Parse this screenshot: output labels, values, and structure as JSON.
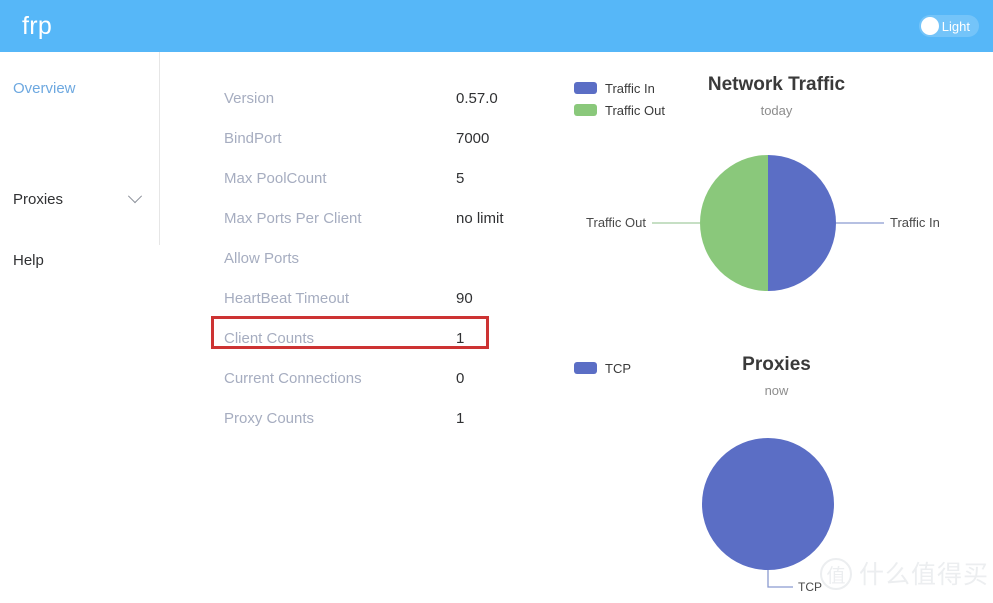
{
  "header": {
    "brand": "frp",
    "theme_toggle_label": "Light",
    "background_color": "#56b7f8"
  },
  "sidebar": {
    "items": [
      {
        "label": "Overview",
        "active": true,
        "icon": null
      },
      {
        "label": "Proxies",
        "active": false,
        "icon": "chevron-down-icon"
      },
      {
        "label": "Help",
        "active": false,
        "icon": null
      }
    ],
    "active_color": "#6da8e0"
  },
  "server_info": {
    "rows": [
      {
        "label": "Version",
        "value": "0.57.0"
      },
      {
        "label": "BindPort",
        "value": "7000"
      },
      {
        "label": "Max PoolCount",
        "value": "5"
      },
      {
        "label": "Max Ports Per Client",
        "value": "no limit"
      },
      {
        "label": "Allow Ports",
        "value": ""
      },
      {
        "label": "HeartBeat Timeout",
        "value": "90"
      },
      {
        "label": "Client Counts",
        "value": "1"
      },
      {
        "label": "Current Connections",
        "value": "0"
      },
      {
        "label": "Proxy Counts",
        "value": "1"
      }
    ],
    "highlighted_row": "Client Counts",
    "highlight_color": "#cd3333"
  },
  "chart_data": [
    {
      "type": "pie",
      "name": "network-traffic",
      "title": "Network Traffic",
      "subtitle": "today",
      "labels": [
        "Traffic In",
        "Traffic Out"
      ],
      "values": [
        50,
        50
      ],
      "colors": [
        "#5b6ec5",
        "#8ac87b"
      ],
      "legend": [
        "Traffic In",
        "Traffic Out"
      ],
      "legend_position": "top-left",
      "label_left": "Traffic Out",
      "label_right": "Traffic In",
      "start_angle_deg": 0,
      "radius_px": 68
    },
    {
      "type": "pie",
      "name": "proxies",
      "title": "Proxies",
      "subtitle": "now",
      "labels": [
        "TCP"
      ],
      "values": [
        100
      ],
      "colors": [
        "#5b6ec5"
      ],
      "legend": [
        "TCP"
      ],
      "legend_position": "top-left",
      "label_bottom": "TCP",
      "radius_px": 66
    }
  ],
  "watermark": {
    "logo_glyph": "值",
    "text": "什么值得买"
  }
}
